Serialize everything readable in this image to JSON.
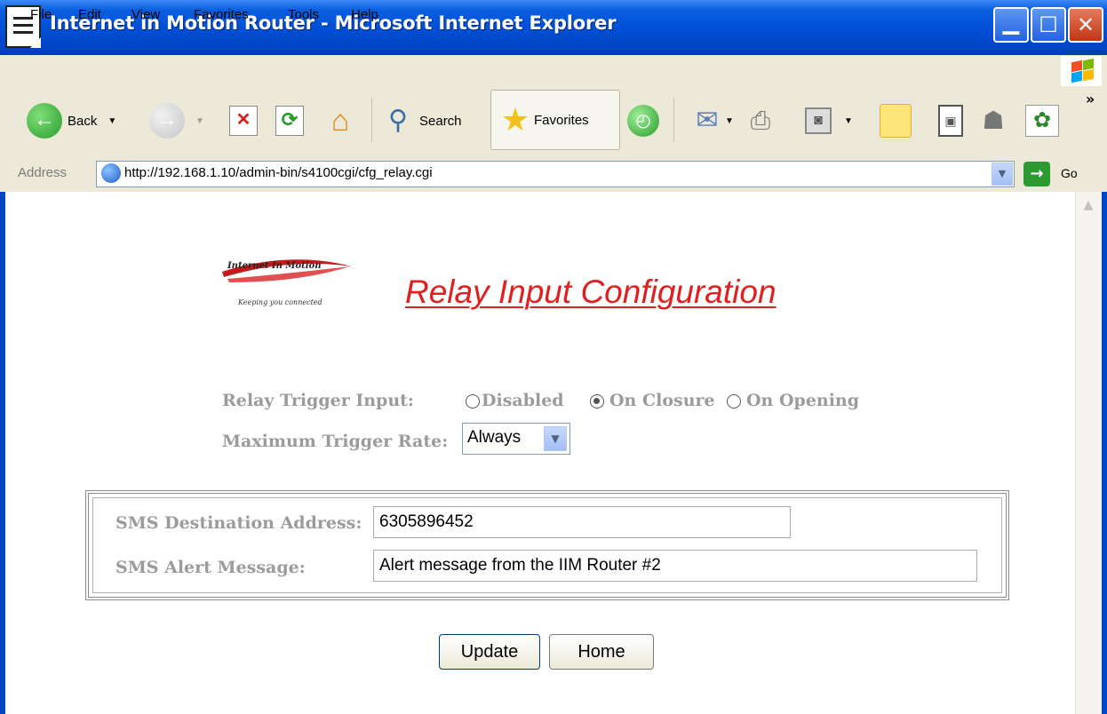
{
  "window": {
    "title": "Internet in Motion Router - Microsoft Internet Explorer",
    "controls": {
      "minimize": "_",
      "maximize": "□",
      "close": "✕"
    }
  },
  "menubar": {
    "items": [
      {
        "label": "File"
      },
      {
        "label": "Edit"
      },
      {
        "label": "View"
      },
      {
        "label": "Favorites"
      },
      {
        "label": "Tools"
      },
      {
        "label": "Help"
      }
    ]
  },
  "toolbar": {
    "back_label": "Back",
    "search_label": "Search",
    "favorites_label": "Favorites",
    "overflow": "»"
  },
  "address": {
    "label": "Address",
    "url": "http://192.168.1.10/admin-bin/s4100cgi/cfg_relay.cgi",
    "go_label": "Go"
  },
  "page": {
    "logo": {
      "brand": "Internet In Motion",
      "tagline": "Keeping you connected"
    },
    "title": "Relay Input Configuration",
    "relay_trigger": {
      "label": "Relay Trigger Input:",
      "options": [
        {
          "label": "Disabled",
          "checked": false
        },
        {
          "label": "On Closure",
          "checked": true
        },
        {
          "label": "On Opening",
          "checked": false
        }
      ]
    },
    "max_rate": {
      "label": "Maximum Trigger Rate:",
      "value": "Always"
    },
    "sms": {
      "dest_label": "SMS Destination Address:",
      "dest_value": "6305896452",
      "msg_label": "SMS Alert Message:",
      "msg_value": "Alert message from the IIM Router #2"
    },
    "buttons": {
      "update": "Update",
      "home": "Home"
    }
  },
  "colors": {
    "titlebar": "#0050d8",
    "page_title": "#e02020",
    "label_gray": "#9b9b9b",
    "chrome": "#ece9d8"
  }
}
